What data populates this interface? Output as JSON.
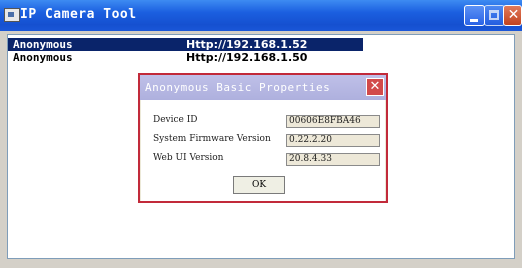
{
  "window": {
    "title": "IP Camera Tool",
    "icon": "camera-app-icon",
    "minimize_icon": "minimize-icon",
    "maximize_icon": "maximize-icon",
    "close_glyph": "✕",
    "title_color": "#1b5fe0"
  },
  "camera_list": {
    "rows": [
      {
        "name": "Anonymous",
        "address": "Http://192.168.1.52",
        "selected": true
      },
      {
        "name": "Anonymous",
        "address": "Http://192.168.1.50",
        "selected": false
      }
    ]
  },
  "dialog": {
    "title": "Anonymous Basic Properties",
    "close_glyph": "✕",
    "fields": [
      {
        "label": "Device ID",
        "value": "00606E8FBA46"
      },
      {
        "label": "System Firmware Version",
        "value": "0.22.2.20"
      },
      {
        "label": "Web UI Version",
        "value": "20.8.4.33"
      }
    ],
    "ok_label": "OK",
    "border_color": "#c22a3a"
  }
}
